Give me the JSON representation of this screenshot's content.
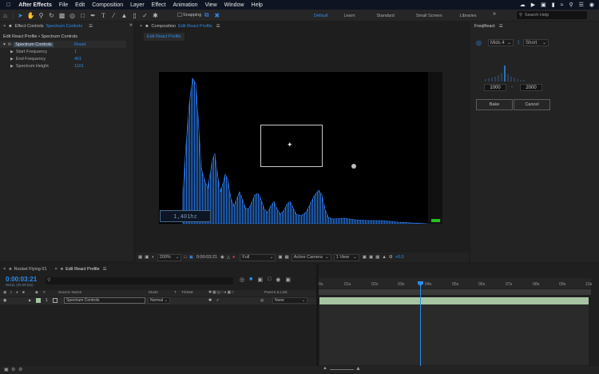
{
  "menubar": {
    "app": "After Effects",
    "items": [
      "File",
      "Edit",
      "Composition",
      "Layer",
      "Effect",
      "Animation",
      "View",
      "Window",
      "Help"
    ]
  },
  "toolbar": {
    "snapping": "Snapping",
    "workspaces": [
      "Default",
      "Learn",
      "Standard",
      "Small Screen",
      "Libraries"
    ],
    "active_workspace": "Default",
    "search_placeholder": "Search Help"
  },
  "effect_controls": {
    "tab_prefix": "Effect Controls",
    "tab_target": "Spectrum Controls",
    "header": "Edit React Profile • Spectrum Controls",
    "effect_name": "Spectrum Controls",
    "reset": "Reset",
    "properties": [
      {
        "label": "Start Frequency",
        "value": "1"
      },
      {
        "label": "End Frequency",
        "value": "401"
      },
      {
        "label": "Spectrum Height",
        "value": "1101"
      }
    ]
  },
  "composition": {
    "tab_prefix": "Composition",
    "tab_name": "Edit React Profile",
    "subtab": "Edit React Profile",
    "overlay_label": "1,401hz",
    "zoom": "200%",
    "timecode": "0:00:03:21",
    "quality": "Full",
    "camera": "Active Camera",
    "views": "1 View",
    "exposure": "+0.0"
  },
  "freqreact": {
    "title": "FreqReact",
    "mode": "Mids 4",
    "length": "Short",
    "low": "1000",
    "high": "2000",
    "separator": "-",
    "bake": "Bake",
    "cancel": "Cancel"
  },
  "timeline": {
    "tabs": [
      "Rocket Flying 01",
      "Edit React Profile"
    ],
    "active_tab": "Edit React Profile",
    "timecode": "0:00:03:21",
    "timecode_sub": "00111 (30.00 fps)",
    "columns": {
      "source": "Source Name",
      "mode": "Mode",
      "t": "T",
      "trkmat": "TrkMat",
      "parent": "Parent & Link"
    },
    "layer": {
      "index": "1",
      "name": "Spectrum Controls",
      "mode": "Normal",
      "parent": "None"
    },
    "ruler": [
      "0s",
      "01s",
      "02s",
      "03s",
      "04s",
      "05s",
      "06s",
      "07s",
      "08s",
      "09s",
      "10s"
    ]
  },
  "colors": {
    "accent": "#2d8ceb",
    "spectrum": "#1e6fd8",
    "layer_bar": "#a7c4a2"
  }
}
